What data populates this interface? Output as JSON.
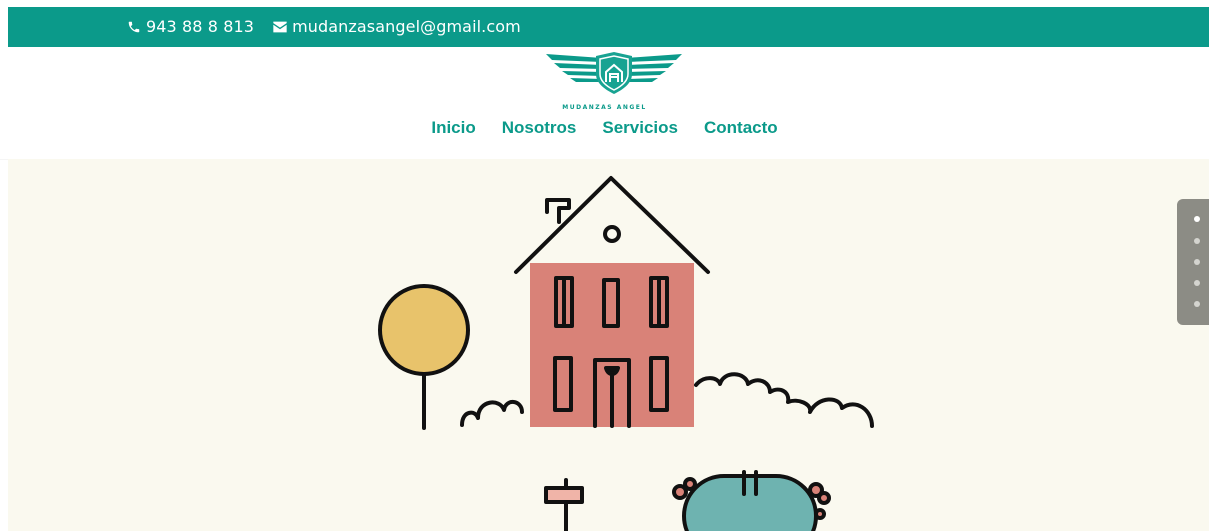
{
  "topbar": {
    "phone": "943 88 8 813",
    "email": "mudanzasangel@gmail.com",
    "phone_icon": "phone-icon",
    "email_icon": "envelope-icon",
    "color": "#0b9a8a"
  },
  "brand": {
    "name": "MUDANZAS ANGEL",
    "color": "#0b9a8a"
  },
  "nav": {
    "items": [
      {
        "label": "Inicio"
      },
      {
        "label": "Nosotros"
      },
      {
        "label": "Servicios"
      },
      {
        "label": "Contacto"
      }
    ]
  },
  "hero": {
    "background": "#faf9ef",
    "house_color": "#d98278",
    "tree_color": "#e8c36b",
    "pool_color": "#6eb3b0"
  },
  "slider": {
    "dots_count": 5,
    "active_index": 0
  }
}
